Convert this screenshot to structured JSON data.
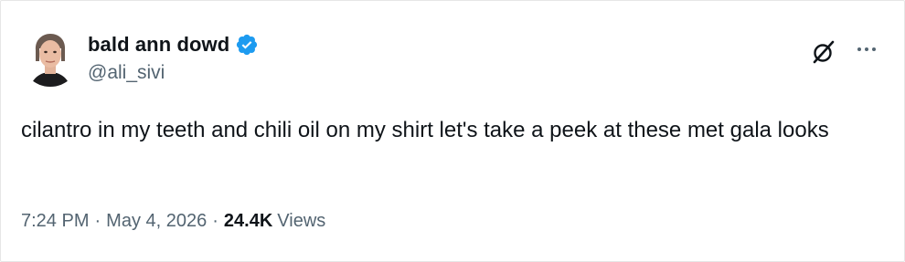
{
  "author": {
    "display_name": "bald ann dowd",
    "handle": "@ali_sivi",
    "verified": true,
    "verified_color": "#1d9bf0"
  },
  "icons": {
    "grok": "grok-icon",
    "more": "more-horizontal-icon"
  },
  "tweet": {
    "text": "cilantro in my teeth and chili oil on my shirt let's take a peek at these met gala looks",
    "time": "7:24 PM",
    "date": "May 4, 2026",
    "separator": "·",
    "views_count": "24.4K",
    "views_label": "Views"
  }
}
